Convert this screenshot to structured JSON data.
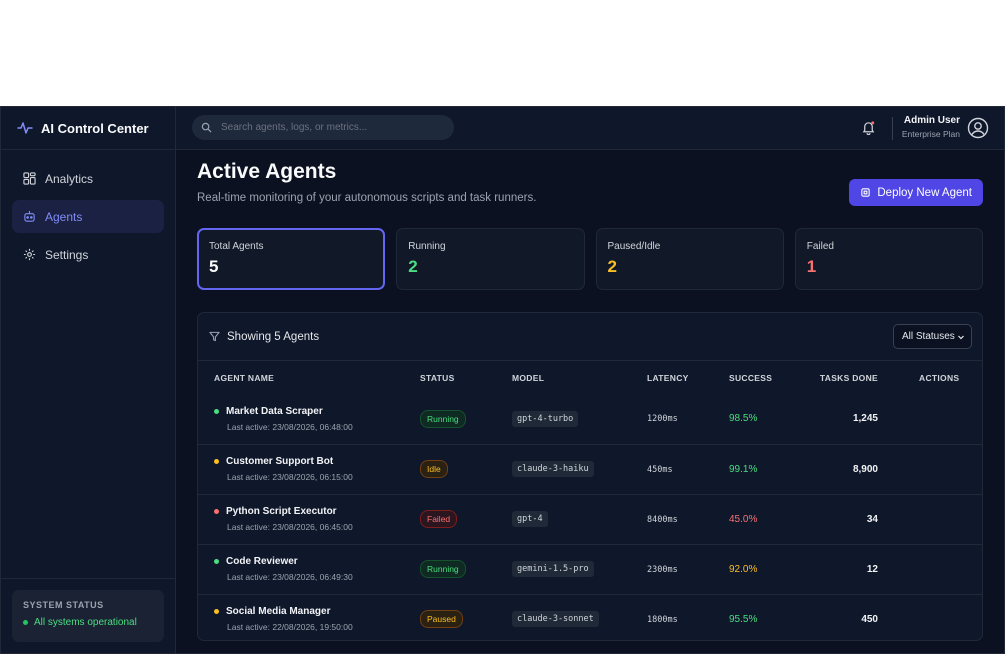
{
  "app": {
    "title": "AI Control Center"
  },
  "sidebar": {
    "items": [
      {
        "label": "Analytics",
        "icon": "grid-icon"
      },
      {
        "label": "Agents",
        "icon": "bot-icon",
        "active": true
      },
      {
        "label": "Settings",
        "icon": "gear-icon"
      }
    ],
    "system": {
      "title": "SYSTEM STATUS",
      "status": "All systems operational"
    }
  },
  "topbar": {
    "search_placeholder": "Search agents, logs, or metrics...",
    "user_name": "Admin User",
    "user_plan": "Enterprise Plan"
  },
  "main": {
    "title": "Active Agents",
    "subtitle": "Real-time monitoring of your autonomous scripts and task runners.",
    "deploy_label": "Deploy New Agent",
    "stats": [
      {
        "label": "Total Agents",
        "value": "5",
        "color": "#f9fafb"
      },
      {
        "label": "Running",
        "value": "2",
        "color": "#4ade80"
      },
      {
        "label": "Paused/Idle",
        "value": "2",
        "color": "#fbbf24"
      },
      {
        "label": "Failed",
        "value": "1",
        "color": "#f87171"
      }
    ],
    "table": {
      "heading": "Showing 5 Agents",
      "filter_value": "All Statuses",
      "columns": [
        "AGENT NAME",
        "STATUS",
        "MODEL",
        "LATENCY",
        "SUCCESS",
        "TASKS DONE",
        "ACTIONS"
      ],
      "rows": [
        {
          "name": "Market Data Scraper",
          "last_active": "Last active: 23/08/2026, 06:48:00",
          "dot": "#4ade80",
          "status": "Running",
          "status_class": "running",
          "model": "gpt-4-turbo",
          "latency": "1200ms",
          "success": "98.5%",
          "success_color": "#4ade80",
          "tasks": "1,245"
        },
        {
          "name": "Customer Support Bot",
          "last_active": "Last active: 23/08/2026, 06:15:00",
          "dot": "#fbbf24",
          "status": "Idle",
          "status_class": "idle",
          "model": "claude-3-haiku",
          "latency": "450ms",
          "success": "99.1%",
          "success_color": "#4ade80",
          "tasks": "8,900"
        },
        {
          "name": "Python Script Executor",
          "last_active": "Last active: 23/08/2026, 06:45:00",
          "dot": "#f87171",
          "status": "Failed",
          "status_class": "failed",
          "model": "gpt-4",
          "latency": "8400ms",
          "success": "45.0%",
          "success_color": "#f87171",
          "tasks": "34"
        },
        {
          "name": "Code Reviewer",
          "last_active": "Last active: 23/08/2026, 06:49:30",
          "dot": "#4ade80",
          "status": "Running",
          "status_class": "running",
          "model": "gemini-1.5-pro",
          "latency": "2300ms",
          "success": "92.0%",
          "success_color": "#fbbf24",
          "tasks": "12"
        },
        {
          "name": "Social Media Manager",
          "last_active": "Last active: 22/08/2026, 19:50:00",
          "dot": "#fbbf24",
          "status": "Paused",
          "status_class": "paused",
          "model": "claude-3-sonnet",
          "latency": "1800ms",
          "success": "95.5%",
          "success_color": "#4ade80",
          "tasks": "450"
        }
      ]
    }
  }
}
